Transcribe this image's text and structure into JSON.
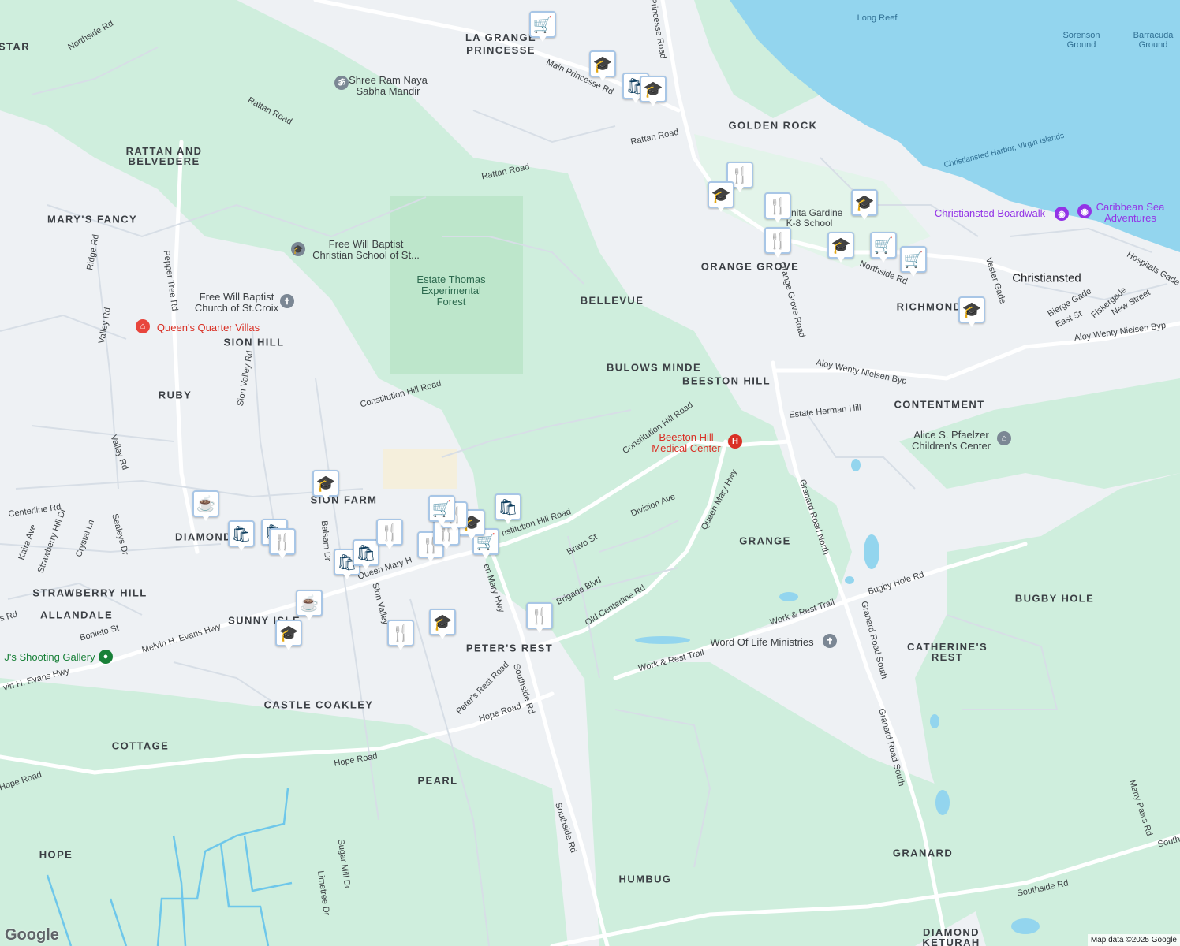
{
  "map": {
    "attribution": "Map data ©2025 Google",
    "logo": "Google",
    "colors": {
      "water": "#93d5ee",
      "land": "#eef1f4",
      "green": "#cfeedd",
      "road": "#c8d2dc",
      "marker_border": "#a8c6e6",
      "marker_icon": "#0b3b5c"
    }
  },
  "areas": {
    "la_grange_princesse": "LA GRANGE\nPRINCESSE",
    "golden_rock": "GOLDEN ROCK",
    "rattan_belvedere": "RATTAN AND\nBELVEDERE",
    "marys_fancy": "MARY'S FANCY",
    "star": "STAR",
    "sion_hill": "SION HILL",
    "ruby": "RUBY",
    "bellevue": "BELLEVUE",
    "orange_grove": "ORANGE GROVE",
    "richmond": "RICHMOND",
    "bulows_minde": "BULOWS MINDE",
    "beeston_hill": "BEESTON HILL",
    "contentment": "CONTENTMENT",
    "sion_farm": "SION FARM",
    "diamond": "DIAMOND",
    "strawberry_hill": "STRAWBERRY HILL",
    "allandale": "ALLANDALE",
    "sunny_isle": "SUNNY ISLE",
    "grange": "GRANGE",
    "bugby_hole": "BUGBY HOLE",
    "peters_rest": "PETER'S REST",
    "catherines_rest": "CATHERINE'S\nREST",
    "castle_coakley": "CASTLE COAKLEY",
    "cottage": "COTTAGE",
    "pearl": "PEARL",
    "hope": "HOPE",
    "granard": "GRANARD",
    "humbug": "HUMBUG",
    "diamond_keturah": "DIAMOND\nKETURAH"
  },
  "cities": {
    "christiansted": "Christiansted"
  },
  "water_labels": {
    "long_reef": "Long Reef",
    "sorenson": "Sorenson\nGround",
    "barracuda": "Barracuda\nGround",
    "harbor": "Christiansted Harbor, Virgin Islands"
  },
  "pois": {
    "shree_ram": "Shree Ram Naya\nSabha Mandir",
    "free_will_school": "Free Will Baptist\nChristian School of St...",
    "estate_thomas": "Estate Thomas\nExperimental\nForest",
    "free_will_church": "Free Will Baptist\nChurch of St.Croix",
    "queens_quarter": "Queen's Quarter Villas",
    "christiansted_boardwalk": "Christiansted Boardwalk",
    "caribbean_sea_adventures": "Caribbean Sea\nAdventures",
    "beeston_hill_medical": "Beeston Hill\nMedical Center",
    "alice_pfaelzer": "Alice S. Pfaelzer\nChildren's Center",
    "word_of_life": "Word Of Life Ministries",
    "shooting_gallery": "J's Shooting Gallery",
    "juanita_gardine": "Juanita Gardine\nK-8 School"
  },
  "roads": {
    "northside_rd": "Northside Rd",
    "rattan_road_1": "Rattan Road",
    "rattan_road_2": "Rattan Road",
    "rattan_road_3": "Rattan Road",
    "main_princesse_rd": "Main Princesse Rd",
    "princesse_road": "Princesse Road",
    "pepper_tree_rd": "Pepper Tree Rd",
    "ridge_rd": "Ridge Rd",
    "valley_rd_1": "Valley Rd",
    "valley_rd_2": "Valley Rd",
    "sion_valley_rd": "Sion Valley Rd",
    "constitution_hill_road_1": "Constitution Hill Road",
    "constitution_hill_road_2": "Constitution Hill Road",
    "constitution_hill_road_3": "nstitution Hill Road",
    "orange_grove_road": "Orange Grove Road",
    "northside_rd_2": "Northside Rd",
    "vester_gade": "Vester Gade",
    "hospitals_gade": "Hospitals Gade",
    "bierge_gade": "Bierge Gade",
    "east_st": "East St",
    "fiskergade": "Fiskergade",
    "new_street": "New Street",
    "aloy_byp_1": "Aloy Wenty Nielsen Byp",
    "aloy_byp_2": "Aloy Wenty Nielsen Byp",
    "estate_herman_hill": "Estate Herman Hill",
    "granard_road_north": "Granard Road North",
    "granard_road_south_1": "Granard Road South",
    "granard_road_south_2": "Granard Road South",
    "queen_mary_hwy_1": "Queen Mary Hwy",
    "queen_mary_hwy_2": "Queen Mary H",
    "queen_mary_hwy_3": "en Mary Hwy",
    "division_ave": "Division Ave",
    "bravo_st": "Bravo St",
    "brigade_blvd": "Brigade Blvd",
    "old_centerline_rd": "Old Centerline Rd",
    "bugby_hole_rd": "Bugby Hole Rd",
    "work_rest_trail_1": "Work & Rest Trail",
    "work_rest_trail_2": "Work & Rest Trail",
    "centerline_rd": "Centerline Rd",
    "kaira_ave": "Kaira Ave",
    "strawberry_hill_dr": "Strawberry Hill Dr",
    "crystal_ln": "Crystal Ln",
    "sealeys_dr": "Sealeys Dr",
    "balsam_dr": "Balsam Dr",
    "sion_valley_2": "Sion Valley",
    "bonieto_st": "Bonieto St",
    "melvin_evans_1": "Melvin H. Evans Hwy",
    "melvin_evans_2": "vin H. Evans Hwy",
    "southside_rd_1": "Southside Rd",
    "southside_rd_2": "Southside Rd",
    "southside_rd_3": "Southside Rd",
    "peters_rest_road": "Peter's Rest Road",
    "hope_road_1": "Hope Road",
    "hope_road_2": "Hope Road",
    "hope_road_3": "Hope Road",
    "sugar_mill_dr": "Sugar Mill Dr",
    "limetree_dr": "Limetree Dr",
    "many_paws_rd": "Many Paws Rd",
    "ns_rd": "ns Rd",
    "southside_far": "South"
  },
  "markers": [
    {
      "icon": "cart-icon",
      "glyph": "🛒"
    },
    {
      "icon": "school-icon",
      "glyph": "🎓"
    },
    {
      "icon": "shopping-bag-icon",
      "glyph": "🛍"
    },
    {
      "icon": "school-icon",
      "glyph": "🎓"
    },
    {
      "icon": "restaurant-icon",
      "glyph": "🍴"
    },
    {
      "icon": "school-icon",
      "glyph": "🎓"
    },
    {
      "icon": "restaurant-icon",
      "glyph": "🍴"
    },
    {
      "icon": "restaurant-icon",
      "glyph": "🍴"
    },
    {
      "icon": "school-icon",
      "glyph": "🎓"
    },
    {
      "icon": "school-icon",
      "glyph": "🎓"
    },
    {
      "icon": "cart-icon",
      "glyph": "🛒"
    },
    {
      "icon": "cart-icon",
      "glyph": "🛒"
    },
    {
      "icon": "school-icon",
      "glyph": "🎓"
    },
    {
      "icon": "school-icon",
      "glyph": "🎓"
    },
    {
      "icon": "coffee-icon",
      "glyph": "☕"
    },
    {
      "icon": "shopping-bag-icon",
      "glyph": "🛍"
    },
    {
      "icon": "shopping-bag-icon",
      "glyph": "🛍"
    },
    {
      "icon": "restaurant-icon",
      "glyph": "🍴"
    },
    {
      "icon": "shopping-bag-icon",
      "glyph": "🛍"
    },
    {
      "icon": "shopping-bag-icon",
      "glyph": "🛍"
    },
    {
      "icon": "restaurant-icon",
      "glyph": "🍴"
    },
    {
      "icon": "cart-icon",
      "glyph": "🛒"
    },
    {
      "icon": "restaurant-icon",
      "glyph": "🍴"
    },
    {
      "icon": "school-icon",
      "glyph": "🎓"
    },
    {
      "icon": "restaurant-icon",
      "glyph": "🍴"
    },
    {
      "icon": "restaurant-icon",
      "glyph": "🍴"
    },
    {
      "icon": "cart-icon",
      "glyph": "🛒"
    },
    {
      "icon": "shopping-bag-icon",
      "glyph": "🛍"
    },
    {
      "icon": "coffee-icon",
      "glyph": "☕"
    },
    {
      "icon": "school-icon",
      "glyph": "🎓"
    },
    {
      "icon": "restaurant-icon",
      "glyph": "🍴"
    },
    {
      "icon": "school-icon",
      "glyph": "🎓"
    },
    {
      "icon": "restaurant-icon",
      "glyph": "🍴"
    }
  ]
}
